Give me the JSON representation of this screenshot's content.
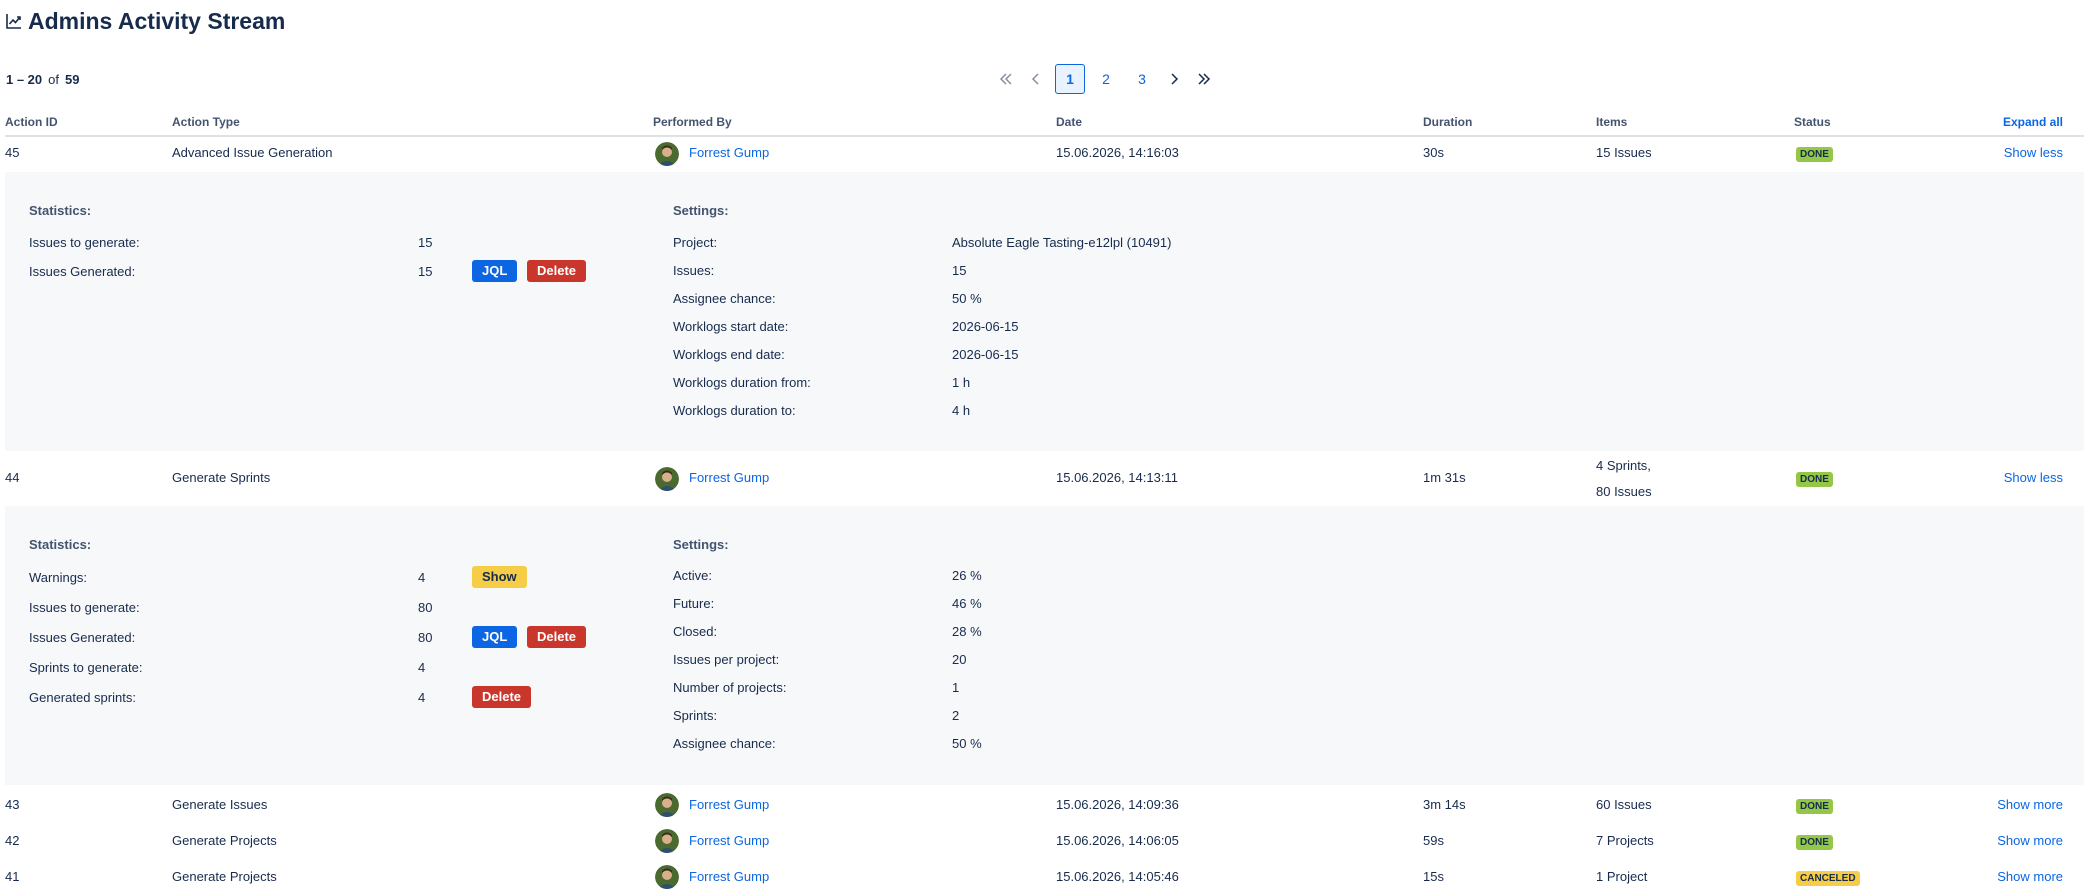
{
  "header": {
    "title": "Admins Activity Stream",
    "title_icon": "line-chart-icon"
  },
  "range": {
    "from_to": "1 – 20",
    "of_label": "of",
    "total": "59"
  },
  "pagination": {
    "first_icon": "double-chevron-left-icon",
    "prev_icon": "chevron-left-icon",
    "next_icon": "chevron-right-icon",
    "last_icon": "double-chevron-right-icon",
    "pages": [
      "1",
      "2",
      "3"
    ],
    "current_page": "1"
  },
  "table": {
    "columns": {
      "action_id": "Action ID",
      "action_type": "Action Type",
      "performed_by": "Performed By",
      "date": "Date",
      "duration": "Duration",
      "items": "Items",
      "status": "Status",
      "expand_all": "Expand all"
    },
    "rows": [
      {
        "id": "45",
        "type": "Advanced Issue Generation",
        "user": "Forrest Gump",
        "date": "15.06.2026, 14:16:03",
        "duration": "30s",
        "items": "15 Issues",
        "items2": "",
        "status": "DONE",
        "toggle": "Show less"
      },
      {
        "id": "44",
        "type": "Generate Sprints",
        "user": "Forrest Gump",
        "date": "15.06.2026, 14:13:11",
        "duration": "1m 31s",
        "items": "4 Sprints,",
        "items2": "80 Issues",
        "status": "DONE",
        "toggle": "Show less"
      },
      {
        "id": "43",
        "type": "Generate Issues",
        "user": "Forrest Gump",
        "date": "15.06.2026, 14:09:36",
        "duration": "3m 14s",
        "items": "60 Issues",
        "items2": "",
        "status": "DONE",
        "toggle": "Show more"
      },
      {
        "id": "42",
        "type": "Generate Projects",
        "user": "Forrest Gump",
        "date": "15.06.2026, 14:06:05",
        "duration": "59s",
        "items": "7 Projects",
        "items2": "",
        "status": "DONE",
        "toggle": "Show more"
      },
      {
        "id": "41",
        "type": "Generate Projects",
        "user": "Forrest Gump",
        "date": "15.06.2026, 14:05:46",
        "duration": "15s",
        "items": "1 Project",
        "items2": "",
        "status": "CANCELED",
        "toggle": "Show more"
      }
    ]
  },
  "details": {
    "d45": {
      "statistics_heading": "Statistics:",
      "settings_heading": "Settings:",
      "stats": [
        {
          "label": "Issues to generate:",
          "value": "15"
        },
        {
          "label": "Issues Generated:",
          "value": "15"
        }
      ],
      "settings": [
        {
          "label": "Project:",
          "value": "Absolute Eagle Tasting-e12lpl (10491)"
        },
        {
          "label": "Issues:",
          "value": "15"
        },
        {
          "label": "Assignee chance:",
          "value": "50 %"
        },
        {
          "label": "Worklogs start date:",
          "value": "2026-06-15"
        },
        {
          "label": "Worklogs end date:",
          "value": "2026-06-15"
        },
        {
          "label": "Worklogs duration from:",
          "value": "1 h"
        },
        {
          "label": "Worklogs duration to:",
          "value": "4 h"
        }
      ],
      "jql_label": "JQL",
      "delete_label": "Delete"
    },
    "d44": {
      "statistics_heading": "Statistics:",
      "settings_heading": "Settings:",
      "stats": [
        {
          "label": "Warnings:",
          "value": "4"
        },
        {
          "label": "Issues to generate:",
          "value": "80"
        },
        {
          "label": "Issues Generated:",
          "value": "80"
        },
        {
          "label": "Sprints to generate:",
          "value": "4"
        },
        {
          "label": "Generated sprints:",
          "value": "4"
        }
      ],
      "settings": [
        {
          "label": "Active:",
          "value": "26 %"
        },
        {
          "label": "Future:",
          "value": "46 %"
        },
        {
          "label": "Closed:",
          "value": "28 %"
        },
        {
          "label": "Issues per project:",
          "value": "20"
        },
        {
          "label": "Number of projects:",
          "value": "1"
        },
        {
          "label": "Sprints:",
          "value": "2"
        },
        {
          "label": "Assignee chance:",
          "value": "50 %"
        }
      ],
      "show_label": "Show",
      "jql_label": "JQL",
      "delete_label": "Delete"
    }
  },
  "colors": {
    "link": "#0c66e4",
    "done_badge": "#94c748",
    "canceled_badge": "#f5cd47",
    "jql_button": "#0c66e4",
    "delete_button": "#c9372c",
    "show_button": "#f5cd47",
    "detail_background": "#f7f8f9"
  }
}
